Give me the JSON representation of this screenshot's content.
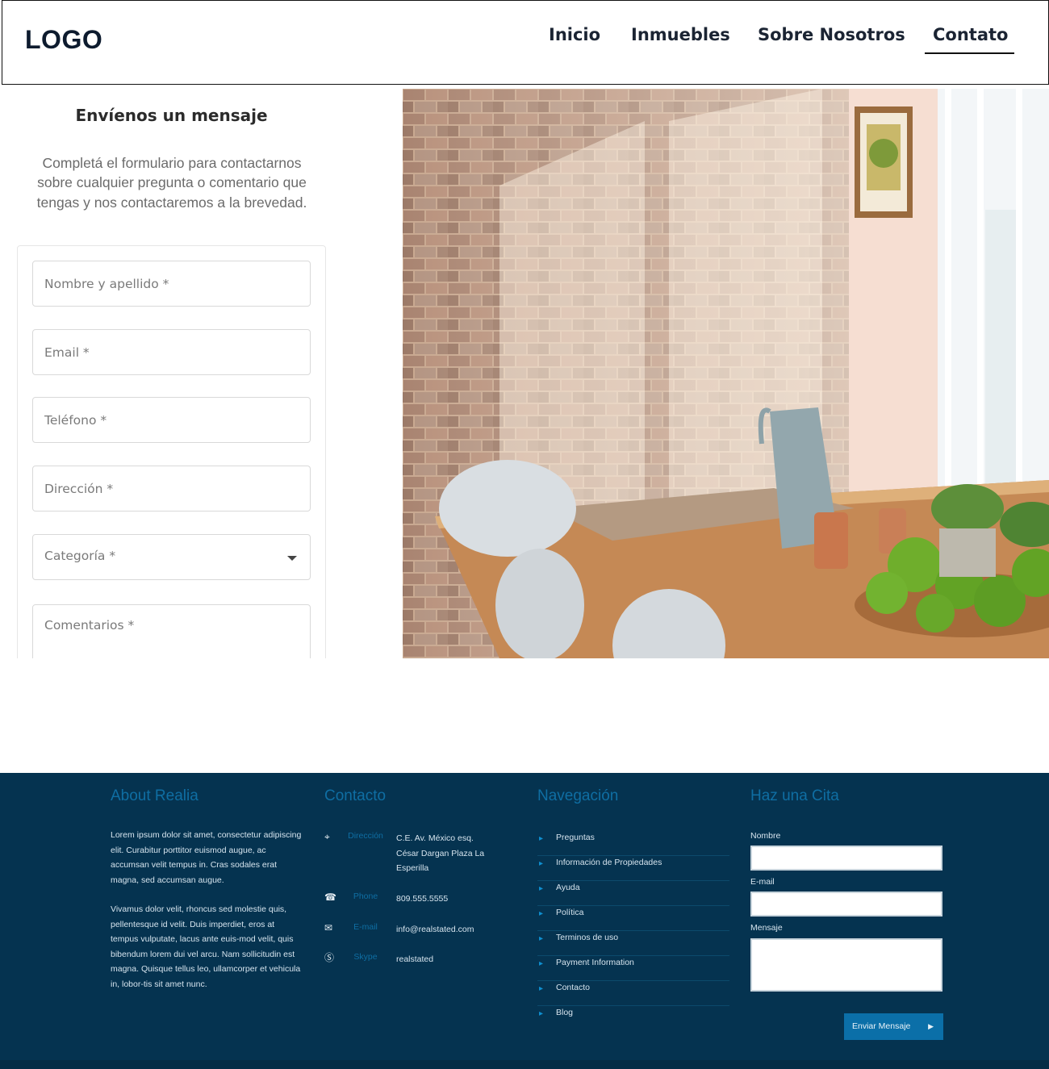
{
  "header": {
    "logo": "LOGO",
    "nav": [
      {
        "label": "Inicio"
      },
      {
        "label": "Inmuebles"
      },
      {
        "label": "Sobre Nosotros"
      },
      {
        "label": "Contato",
        "active": true
      }
    ]
  },
  "form": {
    "title": "Envíenos un mensaje",
    "description": "Completá el formulario para contactarnos sobre cualquier pregunta o comentario que tengas y nos contactaremos a la brevedad.",
    "fields": {
      "name_placeholder": "Nombre y apellido *",
      "email_placeholder": "Email *",
      "phone_placeholder": "Teléfono *",
      "address_placeholder": "Dirección *",
      "category_placeholder": "Categoría *",
      "comments_placeholder": "Comentarios *"
    }
  },
  "hero": {
    "image_icon": "dining-room-photo"
  },
  "footer": {
    "about": {
      "heading": "About Realia",
      "paragraph1": "Lorem ipsum dolor sit amet, consectetur adipiscing elit. Curabitur porttitor euismod augue, ac accumsan velit tempus in. Cras sodales erat magna, sed accumsan augue.",
      "paragraph2": "Vivamus dolor velit, rhoncus sed molestie quis, pellentesque id velit. Duis imperdiet, eros at tempus vulputate, lacus ante euis-mod velit, quis bibendum lorem dui vel arcu. Nam sollicitudin est magna. Quisque tellus leo, ullamcorper et vehicula in, lobor-tis sit amet nunc."
    },
    "contact": {
      "heading": "Contacto",
      "rows": [
        {
          "icon": "map-pin-icon",
          "label": "Dirección",
          "value": "C.E. Av. México esq. César Dargan Plaza La Esperilla"
        },
        {
          "icon": "phone-icon",
          "label": "Phone",
          "value": "809.555.5555"
        },
        {
          "icon": "email-icon",
          "label": "E-mail",
          "value": "info@realstated.com"
        },
        {
          "icon": "skype-icon",
          "label": "Skype",
          "value": "realstated"
        }
      ]
    },
    "navigation": {
      "heading": "Navegación",
      "links": [
        "Preguntas",
        "Información de Propiedades",
        "Ayuda",
        "Política",
        "Terminos de uso",
        "Payment Information",
        "Contacto",
        "Blog"
      ]
    },
    "appointment": {
      "heading": "Haz una Cita",
      "name_label": "Nombre",
      "email_label": "E-mail",
      "message_label": "Mensaje",
      "send_label": "Enviar Mensaje"
    }
  },
  "colors": {
    "footer_bg": "#053350",
    "footer_accent": "#0f6ea3",
    "button": "#0b6fa8"
  }
}
